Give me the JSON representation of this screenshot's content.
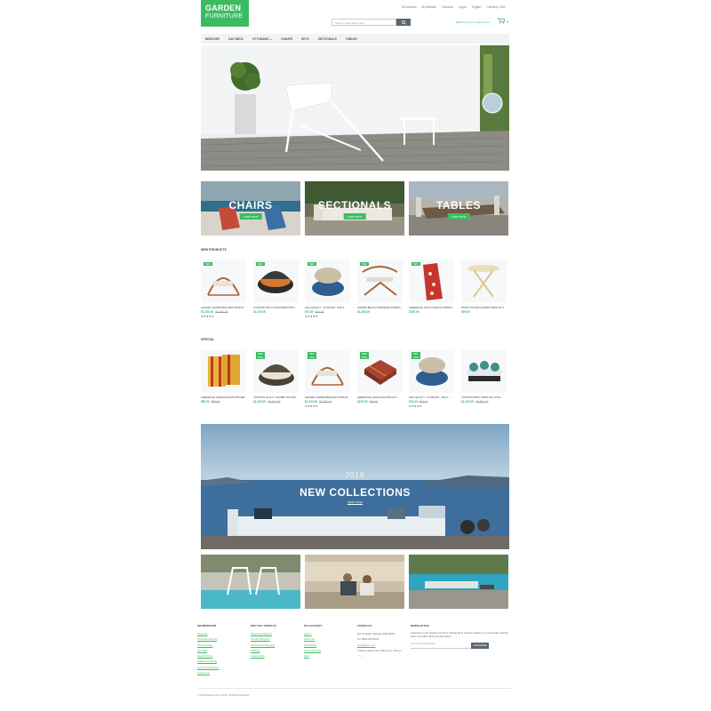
{
  "logo": {
    "line1": "GARDEN",
    "line2": "FURNITURE"
  },
  "top_links": [
    "My Account",
    "My Wishlist",
    "Checkout",
    "Log In",
    "English",
    "Currency: USD"
  ],
  "search": {
    "placeholder": "Search entire store here..."
  },
  "welcome": "Welcome to our online store!",
  "nav": [
    "BENCHES",
    "DAY BEDS",
    "OTTOMANS ⌄",
    "CHAIRS",
    "SETS",
    "SECTIONALS",
    "TABLES"
  ],
  "categories": [
    {
      "title": "CHAIRS",
      "button": "SHOP NOW"
    },
    {
      "title": "SECTIONALS",
      "button": "SHOP NOW"
    },
    {
      "title": "TABLES",
      "button": "SHOP NOW"
    }
  ],
  "new_products": {
    "title": "NEW PRODUCTS",
    "items": [
      {
        "badge": "NEW",
        "name": "LEISURE GARDEN BENCHES SWING B...",
        "price": "$1,200.00",
        "old": "$1,000.00",
        "stars": "★★★★★"
      },
      {
        "badge": "NEW",
        "name": "OUTDOOR PATIO SUN DAYBED WITH...",
        "price": "$1,220.00",
        "old": "",
        "stars": ""
      },
      {
        "badge": "NEW",
        "name": "HIGH QUALITY - OUTDOOR - ONE S...",
        "price": "$70.00",
        "old": "$10.00",
        "stars": "★★★★★"
      },
      {
        "badge": "NEW",
        "name": "GARDEN BEACH OVERSIZED HAMMOC...",
        "price": "$1,480.00",
        "old": "",
        "stars": ""
      },
      {
        "badge": "NEW",
        "name": "GREENDALE FOUR CUSHION HAMMOC...",
        "price": "$190.00",
        "old": "",
        "stars": ""
      },
      {
        "badge": "",
        "name": "WOOD FOLDING GARDEN TABLE BY N...",
        "price": "$90.00",
        "old": "",
        "stars": ""
      }
    ]
  },
  "special": {
    "title": "SPECIAL",
    "items": [
      {
        "badge": "",
        "sale": "",
        "name": "GREENDALE HOME FASHIONS WICKER...",
        "price": "$80.00",
        "old": "$90.00",
        "stars": ""
      },
      {
        "badge": "NEW",
        "sale": "SALE",
        "name": "OUTDOOR QUALITY DAYBED SUN SET...",
        "price": "$1,000.00",
        "old": "$1,600.00",
        "stars": ""
      },
      {
        "badge": "NEW",
        "sale": "SALE",
        "name": "LEISURE GARDEN BENCHES SWING B...",
        "price": "$1,200.00",
        "old": "$1,000.00",
        "stars": "★★★★★"
      },
      {
        "badge": "NEW",
        "sale": "SALE",
        "name": "GREENDALE HOME FASHIONS OUT...",
        "price": "$150.00",
        "old": "$90.00",
        "stars": ""
      },
      {
        "badge": "NEW",
        "sale": "SALE",
        "name": "HIGH QUALITY - OUTDOOR - ONE S...",
        "price": "$70.00",
        "old": "$10.00",
        "stars": "★★★★★"
      },
      {
        "badge": "",
        "sale": "",
        "name": "OUTDOOR PATIO SWING SET WITH...",
        "price": "$1,200.00",
        "old": "$1,800.00",
        "stars": ""
      }
    ]
  },
  "banner": {
    "year": "2016",
    "title": "NEW COLLECTIONS",
    "link": "SHOP NOW!"
  },
  "footer": {
    "information": {
      "title": "INFORMATION",
      "links": [
        "About Us",
        "Customer Service",
        "Privacy Policy",
        "Site Map",
        "Search Terms",
        "Advanced Search",
        "Orders and Returns",
        "Contact Us"
      ]
    },
    "why_buy": {
      "title": "WHY BUY FROM US",
      "links": [
        "Shipping & Returns",
        "Secure Shopping",
        "International Shipping",
        "Affiliates",
        "Group Sales"
      ]
    },
    "my_account": {
      "title": "MY ACCOUNT",
      "links": [
        "Sign In",
        "View Cart",
        "My Wishlist",
        "Track My Order",
        "Help"
      ]
    },
    "contacts": {
      "title": "CONTACTS",
      "lines": [
        "My Company Glasgow D04 89GR",
        "Tel: 0800 234 5678",
        "info@demo.com",
        "7 Days a week from 9:00 am to 7:00 pm"
      ]
    },
    "newsletter": {
      "title": "NEWSLETTER",
      "text": "Subscribe to the Garden Furniture mailing list to receive updates on new arrivals, special offers and other discount information.",
      "placeholder": "Enter your email address",
      "button": "SUBSCRIBE"
    },
    "copyright": "© 2016 Magento Demo Store. All Rights Reserved."
  },
  "colors": {
    "accent": "#3dbb63",
    "nav_bg": "#f1f3f5",
    "button_dark": "#5b6670"
  }
}
